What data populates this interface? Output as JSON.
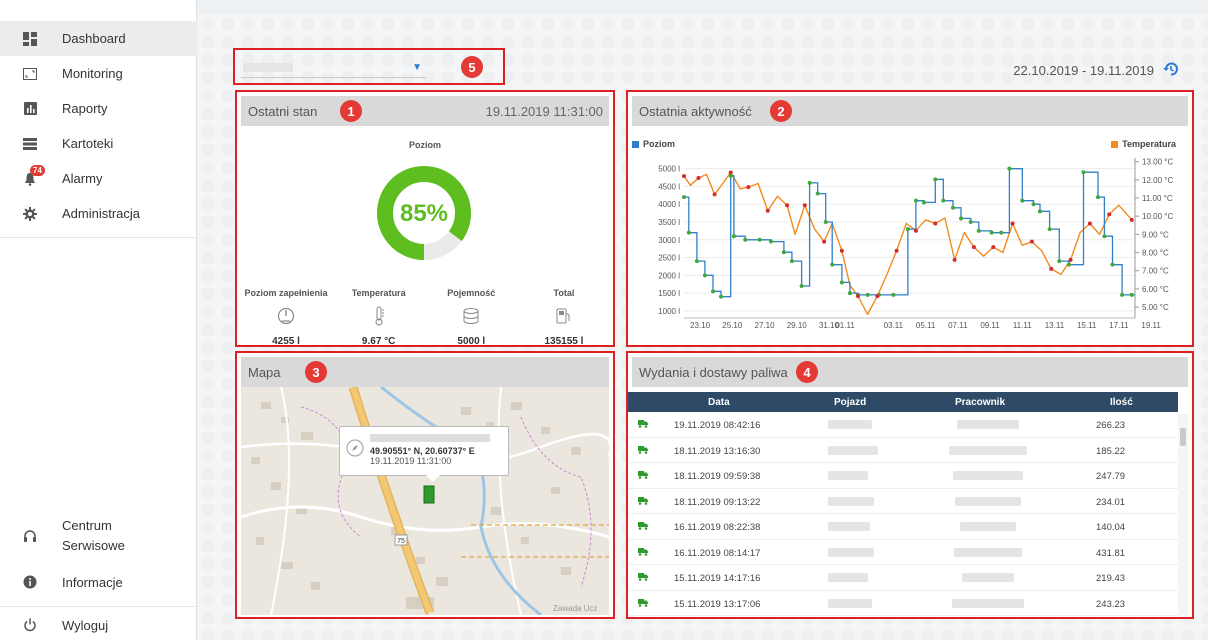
{
  "sidebar": {
    "items": [
      {
        "label": "Dashboard",
        "icon": "dashboard-icon"
      },
      {
        "label": "Monitoring",
        "icon": "monitor-icon"
      },
      {
        "label": "Raporty",
        "icon": "report-icon"
      },
      {
        "label": "Kartoteki",
        "icon": "list-icon"
      },
      {
        "label": "Alarmy",
        "icon": "bell-icon",
        "badge": "74"
      },
      {
        "label": "Administracja",
        "icon": "gear-icon"
      }
    ],
    "bottom": [
      {
        "label": "Centrum",
        "label2": "Serwisowe",
        "icon": "headset-icon"
      },
      {
        "label": "Informacje",
        "icon": "info-icon"
      },
      {
        "label": "Wyloguj",
        "icon": "power-icon"
      }
    ]
  },
  "markers": [
    "1",
    "2",
    "3",
    "4",
    "5"
  ],
  "header": {
    "date_range": "22.10.2019 - 19.11.2019"
  },
  "last_state": {
    "title": "Ostatni stan",
    "timestamp": "19.11.2019 11:31:00",
    "gauge_label": "Poziom",
    "gauge_value": "85%",
    "gauge_fraction": 0.85,
    "stats": [
      {
        "label": "Poziom zapełnienia",
        "value": "4255 l",
        "icon": "gauge-icon"
      },
      {
        "label": "Temperatura",
        "value": "9.67 °C",
        "icon": "thermometer-icon"
      },
      {
        "label": "Pojemność",
        "value": "5000 l",
        "icon": "database-icon"
      },
      {
        "label": "Total",
        "value": "135155 l",
        "icon": "fuel-pump-icon"
      }
    ]
  },
  "activity": {
    "title": "Ostatnia aktywność",
    "legend_left": "Poziom",
    "legend_right": "Temperatura"
  },
  "chart_data": {
    "type": "line",
    "title": "",
    "xlabel": "",
    "ylabel": "",
    "x_ticks": [
      "23.10",
      "25.10",
      "27.10",
      "29.10",
      "31.10",
      "01.11",
      "03.11",
      "05.11",
      "07.11",
      "09.11",
      "11.11",
      "13.11",
      "15.11",
      "17.11",
      "19.11"
    ],
    "y_left_ticks": [
      "5000 l",
      "4500 l",
      "4000 l",
      "3500 l",
      "3000 l",
      "2500 l",
      "2000 l",
      "1500 l",
      "1000 l"
    ],
    "y_right_ticks": [
      "13.00 °C",
      "12.00 °C",
      "11.00 °C",
      "10.00 °C",
      "9.00 °C",
      "8.00 °C",
      "7.00 °C",
      "6.00 °C",
      "5.00 °C"
    ],
    "ylim_left": [
      800,
      5300
    ],
    "ylim_right": [
      4.4,
      13.2
    ],
    "series": [
      {
        "name": "Poziom",
        "unit": "l",
        "color": "#2f7fc9",
        "x": [
          22.0,
          22.3,
          22.8,
          23.3,
          23.8,
          24.3,
          24.9,
          25.1,
          25.8,
          26.7,
          27.4,
          28.2,
          28.7,
          29.3,
          29.8,
          30.3,
          30.8,
          31.2,
          31.8,
          32.3,
          32.8,
          33.4,
          34.1,
          35.0,
          35.9,
          36.4,
          36.9,
          37.6,
          38.1,
          38.7,
          39.2,
          39.8,
          40.3,
          41.1,
          41.7,
          42.2,
          43.0,
          43.7,
          44.1,
          44.7,
          45.3,
          45.9,
          46.8,
          47.7,
          48.1,
          48.6,
          49.2,
          49.8
        ],
        "values": [
          4200,
          3200,
          2400,
          2000,
          1550,
          1400,
          4800,
          3100,
          3000,
          3000,
          2950,
          2650,
          2400,
          1700,
          4600,
          4300,
          3500,
          2300,
          1800,
          1500,
          1450,
          1450,
          1450,
          1450,
          3300,
          4100,
          4050,
          4700,
          4100,
          3900,
          3600,
          3500,
          3250,
          3200,
          3200,
          5000,
          4100,
          4000,
          3800,
          3300,
          2400,
          2300,
          4900,
          4200,
          3100,
          2300,
          1450,
          1450
        ]
      },
      {
        "name": "Temperatura",
        "unit": "°C",
        "color": "#f28a1c",
        "x": [
          22.0,
          22.4,
          22.9,
          23.4,
          23.9,
          24.4,
          24.9,
          25.5,
          26.0,
          26.6,
          27.2,
          27.8,
          28.4,
          28.9,
          29.5,
          30.1,
          30.7,
          31.2,
          31.8,
          32.3,
          32.8,
          33.4,
          34.0,
          34.6,
          35.2,
          35.8,
          36.4,
          37.0,
          37.6,
          38.2,
          38.8,
          39.4,
          40.0,
          40.6,
          41.2,
          41.8,
          42.4,
          43.0,
          43.6,
          44.2,
          44.8,
          45.4,
          46.0,
          46.6,
          47.2,
          47.8,
          48.4,
          49.0,
          49.8
        ],
        "values": [
          12.2,
          11.7,
          12.1,
          12.3,
          11.2,
          11.8,
          12.4,
          11.5,
          11.6,
          11.8,
          10.3,
          11.1,
          10.6,
          9.0,
          10.6,
          9.3,
          8.6,
          9.6,
          8.1,
          6.2,
          5.6,
          4.6,
          5.6,
          6.8,
          8.1,
          9.6,
          9.2,
          9.8,
          9.6,
          9.9,
          7.6,
          9.1,
          8.3,
          7.8,
          8.3,
          8.0,
          9.6,
          8.4,
          8.6,
          8.1,
          7.1,
          6.8,
          7.6,
          9.1,
          9.6,
          9.0,
          10.1,
          10.6,
          9.8
        ]
      }
    ]
  },
  "map": {
    "title": "Mapa",
    "coords": "49.90551° N, 20.60737° E",
    "time": "19.11.2019 11:31:00",
    "road_label": "75",
    "place_label": "Zawada Ucz"
  },
  "deliveries": {
    "title": "Wydania i dostawy paliwa",
    "columns": [
      "Data",
      "Pojazd",
      "Pracownik",
      "Ilość"
    ],
    "rows": [
      {
        "date": "19.11.2019 08:42:16",
        "qty": "266.23"
      },
      {
        "date": "18.11.2019 13:16:30",
        "qty": "185.22"
      },
      {
        "date": "18.11.2019 09:59:38",
        "qty": "247.79"
      },
      {
        "date": "18.11.2019 09:13:22",
        "qty": "234.01"
      },
      {
        "date": "16.11.2019 08:22:38",
        "qty": "140.04"
      },
      {
        "date": "16.11.2019 08:14:17",
        "qty": "431.81"
      },
      {
        "date": "15.11.2019 14:17:16",
        "qty": "219.43"
      },
      {
        "date": "15.11.2019 13:17:06",
        "qty": "243.23"
      }
    ]
  },
  "colors": {
    "accent_red": "#e02020",
    "gauge_green": "#5ebd1f",
    "table_header": "#2e4a66",
    "level_blue": "#2f7fc9",
    "temp_orange": "#f28a1c",
    "point_green": "#3ea93a",
    "point_red": "#d62b2b"
  }
}
